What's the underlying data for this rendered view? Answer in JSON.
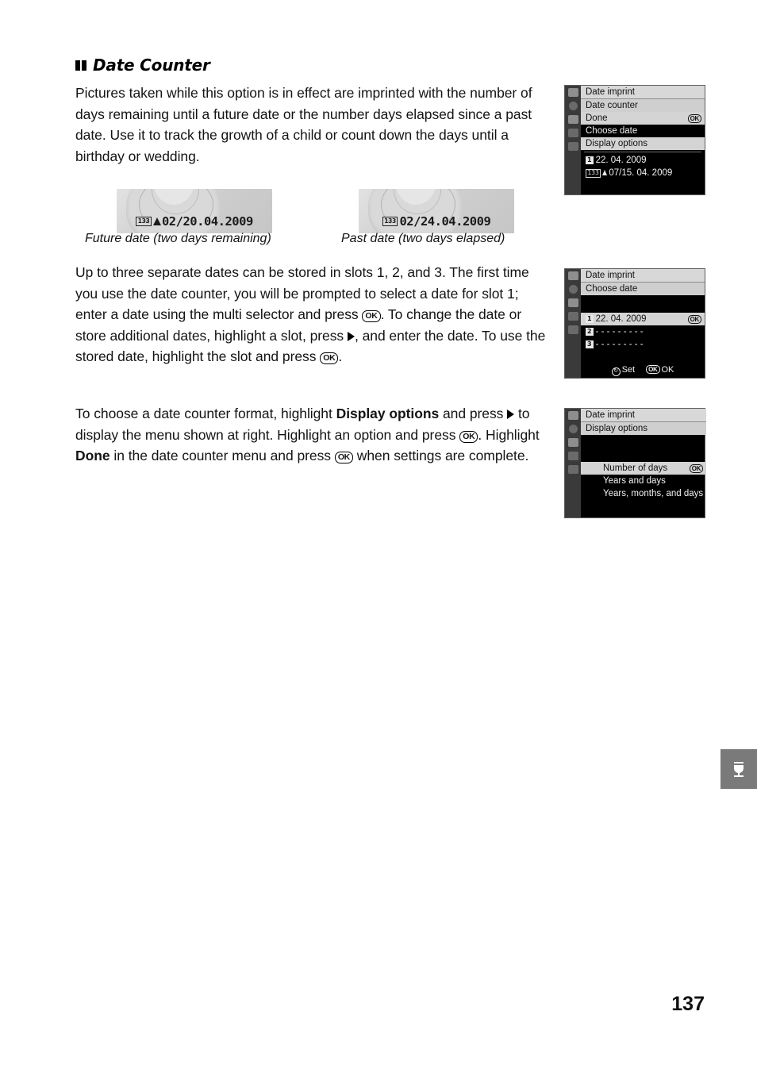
{
  "heading": {
    "text": "Date Counter",
    "marker": "double-square-marker"
  },
  "paragraphs": {
    "p1": "Pictures taken while this option is in effect are imprinted with the number of days remaining until a future date or the number days elapsed since a past date. Use it to track the growth of a child or count down the days until a birthday or wedding.",
    "p2_a": "Up to three separate dates can be stored in slots 1, 2, and 3.  The first time you use the date counter, you will be prompted to select a date for slot 1; enter a date using the multi selector and press ",
    "p2_b": ".  To change the date or store additional dates, highlight a slot, press ",
    "p2_c": ", and enter the date. To use the stored date, highlight the slot and press ",
    "p2_d": ".",
    "p3_a": "To choose a date counter format, highlight ",
    "p3_bold1": "Display options",
    "p3_b": " and press ",
    "p3_c": " to display the menu shown at right.  Highlight an option and press ",
    "p3_d": ".  Highlight ",
    "p3_bold2": "Done",
    "p3_e": " in the date counter menu and press ",
    "p3_f": " when settings are complete.",
    "ok_glyph": "OK"
  },
  "photos": [
    {
      "id": "future-date-photo",
      "stamp_icon": "film-frame-icon",
      "stamp_triangle": "up-triangle-icon",
      "stamp_text": "02/20.04.2009",
      "caption": "Future date (two days remaining)"
    },
    {
      "id": "past-date-photo",
      "stamp_icon": "film-frame-icon",
      "stamp_text": "02/24.04.2009",
      "caption": "Past date (two days elapsed)"
    }
  ],
  "screens": [
    {
      "id": "date-counter-menu",
      "title": "Date imprint",
      "subheader": "Date counter",
      "rows": [
        {
          "label": "Done",
          "ok": "OK",
          "selected": true
        },
        {
          "label": "Choose date",
          "ok": "",
          "selected": false
        },
        {
          "label": "Display options",
          "ok": "",
          "selected": true
        }
      ],
      "entries": [
        {
          "slot": "1",
          "text": "22. 04. 2009"
        },
        {
          "text": "07/15. 04. 2009"
        }
      ]
    },
    {
      "id": "choose-date-menu",
      "title": "Date imprint",
      "subheader": "Choose date",
      "slots": [
        {
          "slot": "1",
          "text": "22. 04. 2009",
          "ok": "OK",
          "selected": true
        },
        {
          "slot": "2",
          "text": "- - - - - - - - -",
          "ok": "",
          "selected": false
        },
        {
          "slot": "3",
          "text": "- - - - - - - - -",
          "ok": "",
          "selected": false
        }
      ],
      "footer_set": "Set",
      "footer_ok_badge": "OK",
      "footer_ok": "OK"
    },
    {
      "id": "display-options-menu",
      "title": "Date imprint",
      "subheader": "Display options",
      "options": [
        {
          "label": "Number of days",
          "ok": "OK",
          "selected": true
        },
        {
          "label": "Years and days",
          "ok": "",
          "selected": false
        },
        {
          "label": "Years, months, and days",
          "ok": "",
          "selected": false
        }
      ]
    }
  ],
  "page_tab": {
    "icon": "setup-menu-icon"
  },
  "page_number": "137"
}
